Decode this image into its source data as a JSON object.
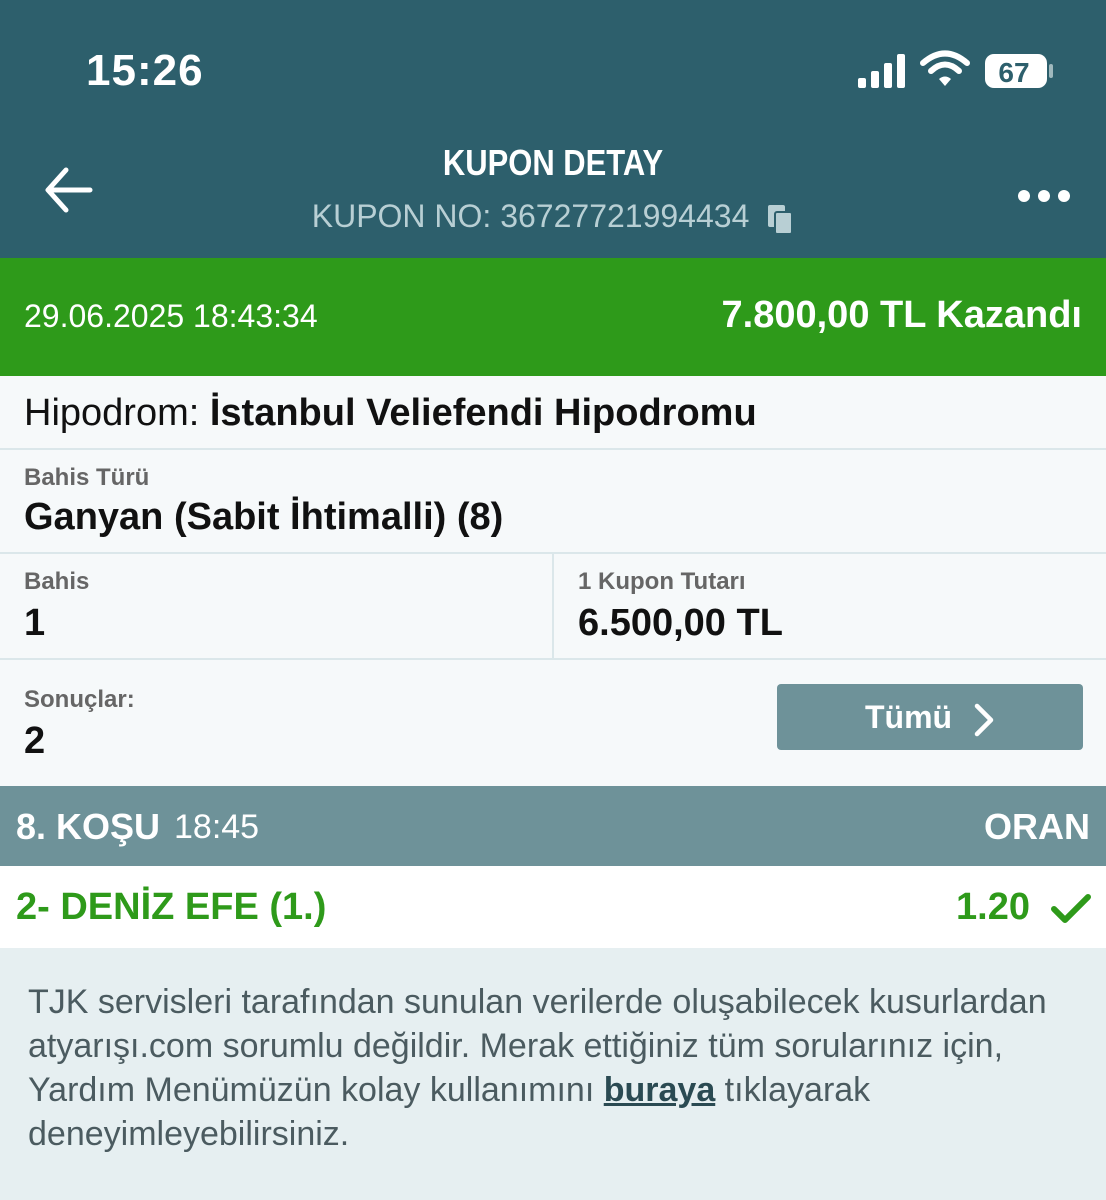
{
  "status": {
    "time": "15:26",
    "battery": "67"
  },
  "header": {
    "title": "KUPON DETAY",
    "coupon_no": "KUPON NO: 36727721994434"
  },
  "summary": {
    "datetime": "29.06.2025 18:43:34",
    "result": "7.800,00 TL Kazandı"
  },
  "hippodrome": {
    "label": "Hipodrom: ",
    "value": "İstanbul Veliefendi Hipodromu"
  },
  "bet_type": {
    "label": "Bahis Türü",
    "value": "Ganyan (Sabit İhtimalli) (8)"
  },
  "bet": {
    "label": "Bahis",
    "value": "1"
  },
  "coupon_amount": {
    "label": "1 Kupon Tutarı",
    "value": "6.500,00 TL"
  },
  "results": {
    "label": "Sonuçlar:",
    "value": "2",
    "button_label": "Tümü"
  },
  "race": {
    "name": "8. KOŞU",
    "time": "18:45",
    "odds_header": "ORAN"
  },
  "selection": {
    "horse": "2- DENİZ EFE (1.)",
    "odds": "1.20"
  },
  "footer": {
    "text_before": "TJK servisleri tarafından sunulan verilerde oluşabilecek kusurlardan atyarışı.com sorumlu değildir. Merak ettiğiniz tüm sorularınız için, Yardım Menümüzün kolay kullanımını ",
    "link": "buraya",
    "text_after": " tıklayarak deneyimleyebilirsiniz."
  },
  "colors": {
    "header": "#2d5f6c",
    "win_green": "#2e9a1a",
    "race_bar": "#6e9299",
    "background": "#e6eff1"
  }
}
